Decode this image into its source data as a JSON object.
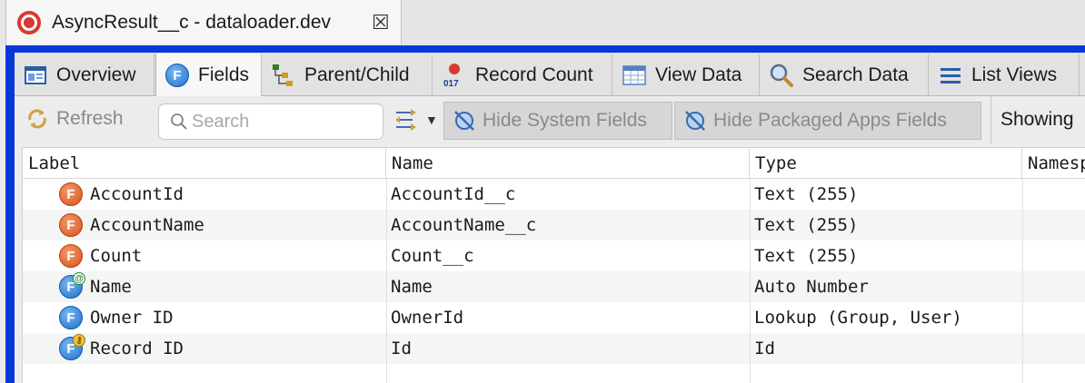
{
  "editor_tab": {
    "title": "AsyncResult__c - dataloader.dev",
    "close_symbol": "☒"
  },
  "page_tabs": [
    {
      "label": "Overview",
      "icon": "overview-icon"
    },
    {
      "label": "Fields",
      "icon": "fields-icon",
      "active": true
    },
    {
      "label": "Parent/Child",
      "icon": "hierarchy-icon"
    },
    {
      "label": "Record Count",
      "icon": "record-count-icon"
    },
    {
      "label": "View Data",
      "icon": "table-icon"
    },
    {
      "label": "Search Data",
      "icon": "magnifier-icon"
    },
    {
      "label": "List Views",
      "icon": "list-icon"
    }
  ],
  "toolbar": {
    "refresh_label": "Refresh",
    "search_placeholder": "Search",
    "hide_system_label": "Hide System Fields",
    "hide_packaged_label": "Hide Packaged Apps Fields",
    "showing_label": "Showing"
  },
  "table": {
    "columns": [
      "Label",
      "Name",
      "Type",
      "Namesp"
    ],
    "rows": [
      {
        "label": "AccountId",
        "name": "AccountId__c",
        "type": "Text (255)",
        "icon": "custom-field-icon"
      },
      {
        "label": "AccountName",
        "name": "AccountName__c",
        "type": "Text (255)",
        "icon": "custom-field-icon"
      },
      {
        "label": "Count",
        "name": "Count__c",
        "type": "Text (255)",
        "icon": "custom-field-icon"
      },
      {
        "label": "Name",
        "name": "Name",
        "type": "Auto Number",
        "icon": "name-field-icon"
      },
      {
        "label": "Owner ID",
        "name": "OwnerId",
        "type": "Lookup (Group, User)",
        "icon": "standard-field-icon"
      },
      {
        "label": "Record ID",
        "name": "Id",
        "type": "Id",
        "icon": "id-field-icon"
      }
    ]
  },
  "colors": {
    "frame": "#0a38d8",
    "custom_field": "#d8501c",
    "standard_field": "#1d6fd0"
  }
}
